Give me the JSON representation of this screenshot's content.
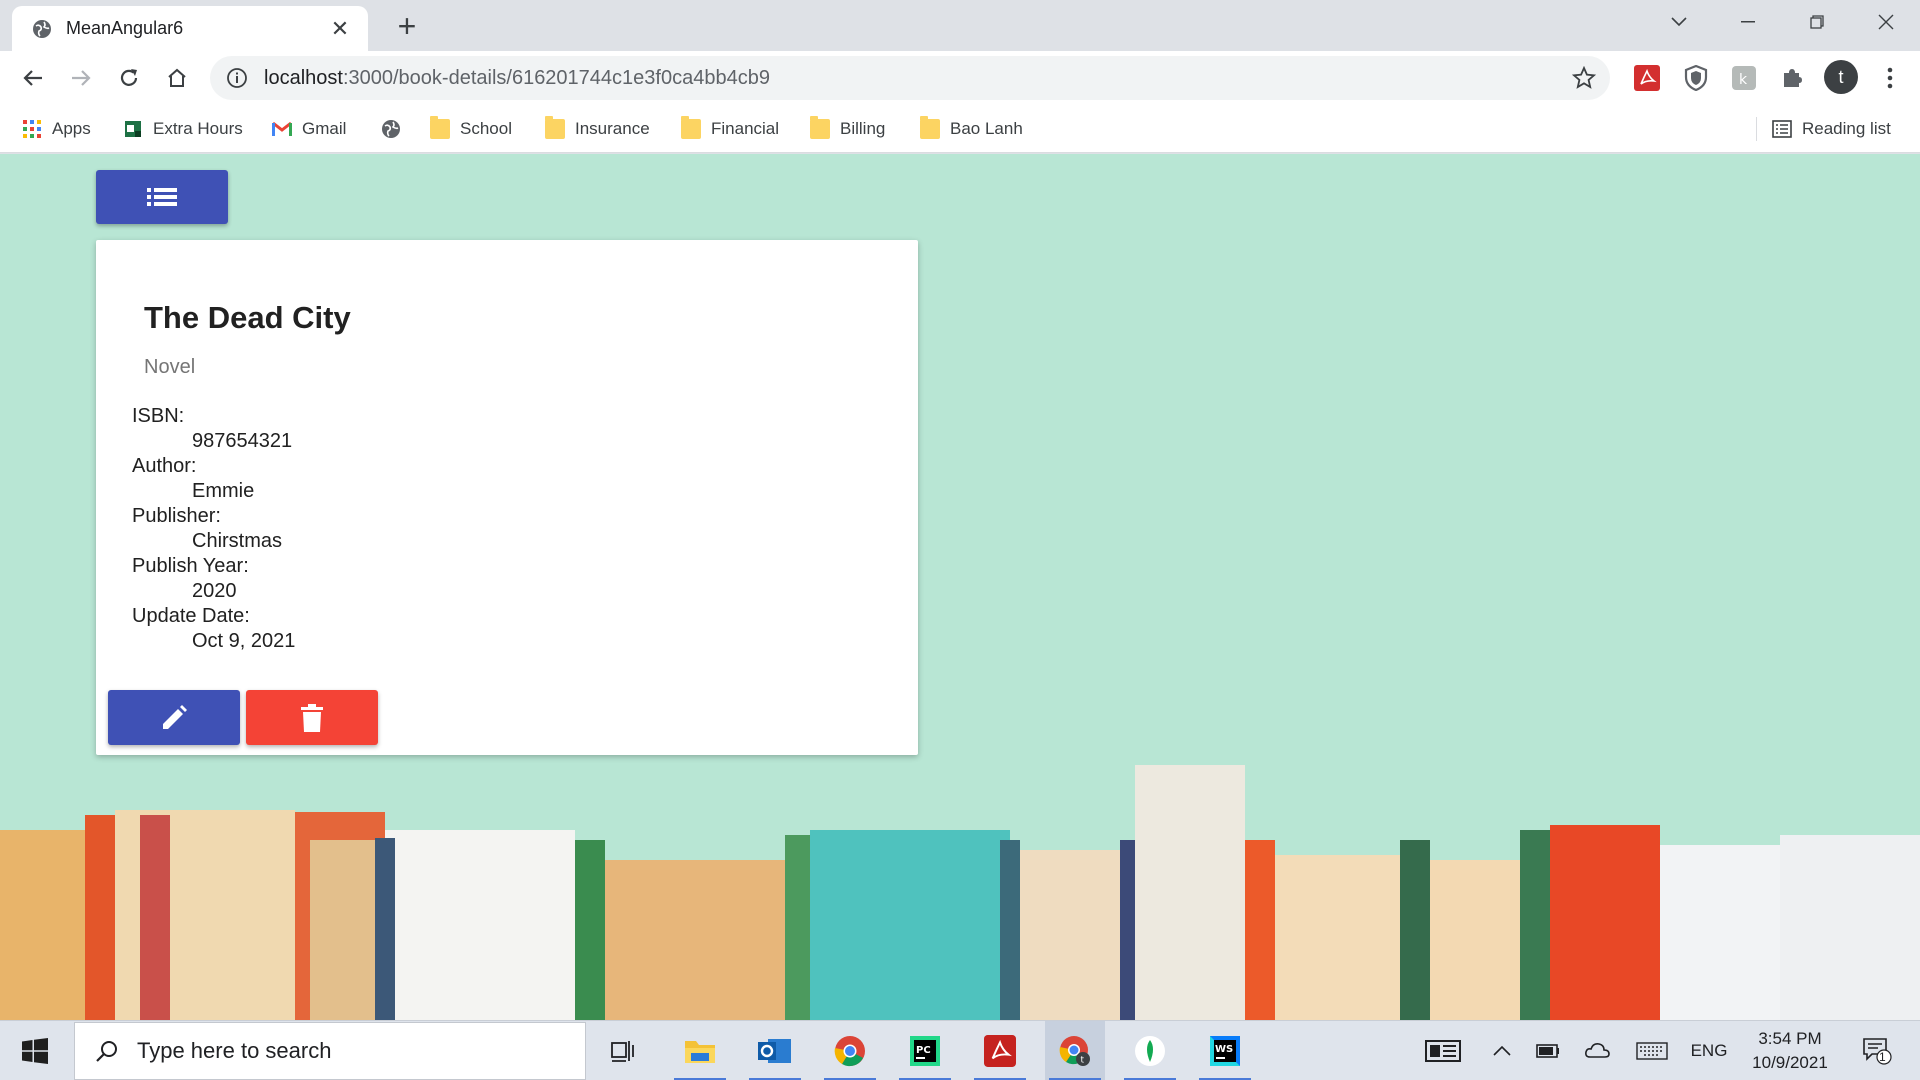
{
  "browser": {
    "tab_title": "MeanAngular6",
    "url_host": "localhost",
    "url_rest": ":3000/book-details/616201744c1e3f0ca4bb4cb9",
    "profile_initial": "t"
  },
  "bookmarks": {
    "items": [
      "Apps",
      "Extra Hours",
      "Gmail",
      "School",
      "Insurance",
      "Financial",
      "Billing",
      "Bao Lanh"
    ],
    "reading_list": "Reading list"
  },
  "book": {
    "title": "The Dead City",
    "subtitle": "Novel",
    "fields": [
      {
        "label": "ISBN:",
        "value": "987654321"
      },
      {
        "label": "Author:",
        "value": "Emmie"
      },
      {
        "label": "Publisher:",
        "value": "Chirstmas"
      },
      {
        "label": "Publish Year:",
        "value": "2020"
      },
      {
        "label": "Update Date:",
        "value": "Oct 9, 2021"
      }
    ]
  },
  "colors": {
    "primary": "#3f51b5",
    "warn": "#f44336",
    "page_bg": "#b8e6d4"
  },
  "taskbar": {
    "search_placeholder": "Type here to search",
    "language": "ENG",
    "time": "3:54 PM",
    "date": "10/9/2021",
    "notifications": "1"
  }
}
